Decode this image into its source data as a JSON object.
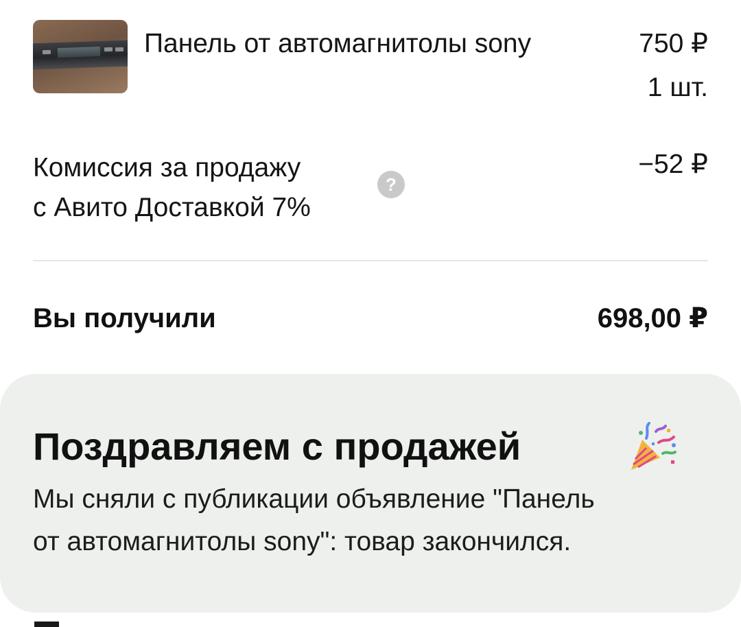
{
  "product": {
    "title": "Панель от автомагнитолы sony",
    "price": "750 ₽",
    "quantity": "1 шт.",
    "thumbnail_icon": "car-stereo-panel-photo"
  },
  "commission": {
    "label_line1": "Комиссия за продажу",
    "label_line2": "с Авито Доставкой 7%",
    "value": "−52 ₽",
    "help_icon_glyph": "?"
  },
  "total": {
    "label": "Вы получили",
    "value": "698,00 ₽"
  },
  "congrats": {
    "title": "Поздравляем с продажей",
    "emoji_icon": "party-popper-icon",
    "message_line1": "Мы сняли с публикации объявление \"Панель",
    "message_line2": "от автомагнитолы sony\": товар закончился."
  },
  "colors": {
    "card_background": "#edf0ec",
    "divider": "#e6e6e6",
    "help_icon": "#c9c9c9",
    "text": "#111111"
  }
}
